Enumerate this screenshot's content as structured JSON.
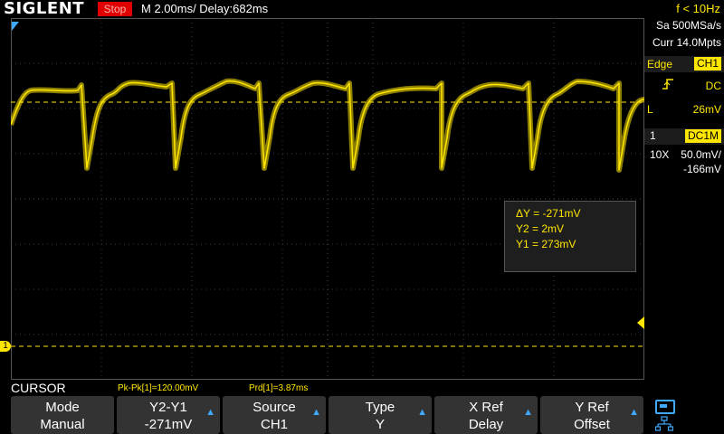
{
  "header": {
    "brand": "SIGLENT",
    "run_state": "Stop",
    "timebase": "M 2.00ms/ Delay:682ms",
    "frequency": "f < 10Hz"
  },
  "acquisition": {
    "sample_rate": "Sa 500MSa/s",
    "memory_depth": "Curr 14.0Mpts"
  },
  "trigger": {
    "type": "Edge",
    "source": "CH1",
    "slope_icon": "rising-edge-icon",
    "coupling": "DC",
    "level_label": "L",
    "level": "26mV"
  },
  "channel": {
    "number": "1",
    "coupling": "DC1M",
    "probe": "10X",
    "scale": "50.0mV/",
    "offset": "-166mV"
  },
  "cursor_readout": {
    "delta_y": "ΔY = -271mV",
    "y2": "Y2 = 2mV",
    "y1": "Y1 = 273mV"
  },
  "menu_title": "CURSOR",
  "measurements": [
    "Pk-Pk[1]=120.00mV",
    "Prd[1]=3.87ms"
  ],
  "softkeys": [
    {
      "top": "Mode",
      "bottom": "Manual",
      "arrow": false
    },
    {
      "top": "Y2-Y1",
      "bottom": "-271mV",
      "arrow": true
    },
    {
      "top": "Source",
      "bottom": "CH1",
      "arrow": true
    },
    {
      "top": "Type",
      "bottom": "Y",
      "arrow": true
    },
    {
      "top": "X Ref",
      "bottom": "Delay",
      "arrow": true
    },
    {
      "top": "Y Ref",
      "bottom": "Offset",
      "arrow": true
    }
  ],
  "marker_channel_label": "1",
  "colors": {
    "trace": "#ffe600",
    "stop_bg": "#e00000",
    "grid": "#3a3a3a",
    "accent": "#3fa9ff"
  }
}
